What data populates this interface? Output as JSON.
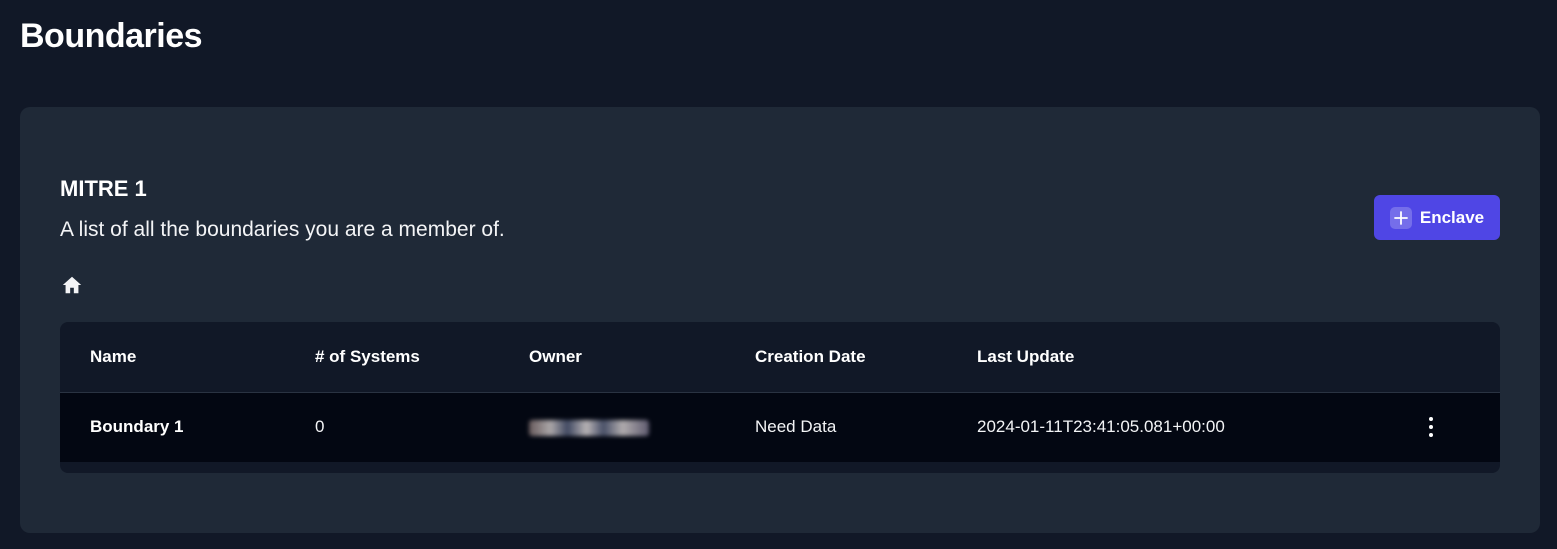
{
  "page": {
    "title": "Boundaries"
  },
  "card": {
    "title": "MITRE 1",
    "subtitle": "A list of all the boundaries you are a member of.",
    "add_button_label": "Enclave"
  },
  "icons": {
    "breadcrumb": "home-icon",
    "add": "plus-icon",
    "row_menu": "kebab-vertical-icon"
  },
  "colors": {
    "background": "#111827",
    "card": "#1f2937",
    "accent": "#4f46e5",
    "row": "#030712"
  },
  "table": {
    "columns": [
      "Name",
      "# of Systems",
      "Owner",
      "Creation Date",
      "Last Update"
    ],
    "rows": [
      {
        "name": "Boundary 1",
        "systems": "0",
        "owner": "",
        "creation_date": "Need Data",
        "last_update": "2024-01-11T23:41:05.081+00:00"
      }
    ]
  }
}
